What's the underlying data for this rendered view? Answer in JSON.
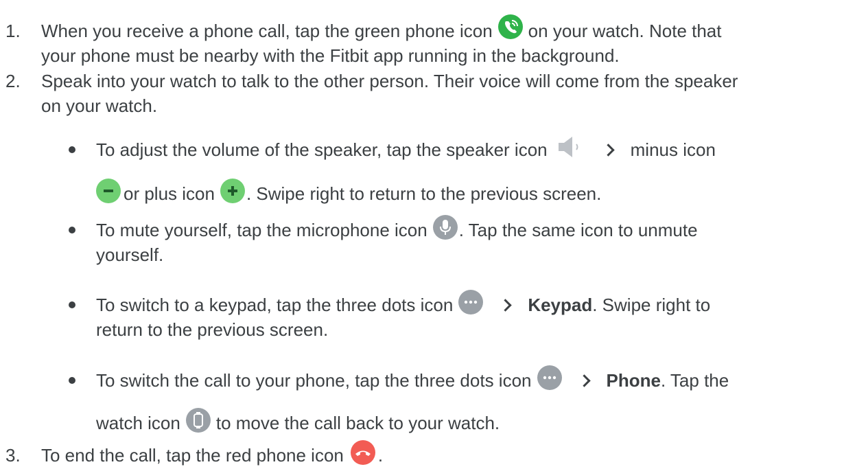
{
  "step1": {
    "number": "1.",
    "line1_a": "When you receive a phone call, tap the green phone icon",
    "line1_b": "on your watch. Note that",
    "line2": "your phone must be nearby with the Fitbit app running in the background."
  },
  "step2": {
    "number": "2.",
    "line1": "Speak into your watch to talk to the other person. Their voice will come from the speaker",
    "line2": "on your watch.",
    "bullets": [
      {
        "line1_a": "To adjust the volume of the speaker, tap the speaker icon",
        "line1_b": "minus icon",
        "line2_a": "or plus icon",
        "line2_b": ". Swipe right to return to the previous screen."
      },
      {
        "line1_a": "To mute yourself, tap the microphone icon",
        "line1_b": ". Tap the same icon to unmute",
        "line2": "yourself."
      },
      {
        "line1_a": "To switch to a keypad, tap the three dots icon",
        "line1_bold": "Keypad",
        "line1_b": ". Swipe right to",
        "line2": "return to the previous screen."
      },
      {
        "line1_a": "To switch the call to your phone, tap the three dots icon",
        "line1_bold": "Phone",
        "line1_b": ". Tap the",
        "line2_a": "watch icon",
        "line2_b": "to move the call back to your watch."
      }
    ]
  },
  "step3": {
    "number": "3.",
    "text": "To end the call, tap the red phone icon",
    "end": "."
  },
  "icons": {
    "green_phone": "phone-call-icon",
    "speaker": "speaker-icon",
    "minus": "minus-icon",
    "plus": "plus-icon",
    "microphone": "microphone-icon",
    "three_dots": "three-dots-icon",
    "watch": "watch-icon",
    "red_phone": "end-call-icon"
  },
  "colors": {
    "text": "#3c4043",
    "green_phone": "#2fb34a",
    "volume_buttons": "#6fcf72",
    "grey_icons": "#9aa0a6",
    "red_phone": "#f25c54"
  }
}
